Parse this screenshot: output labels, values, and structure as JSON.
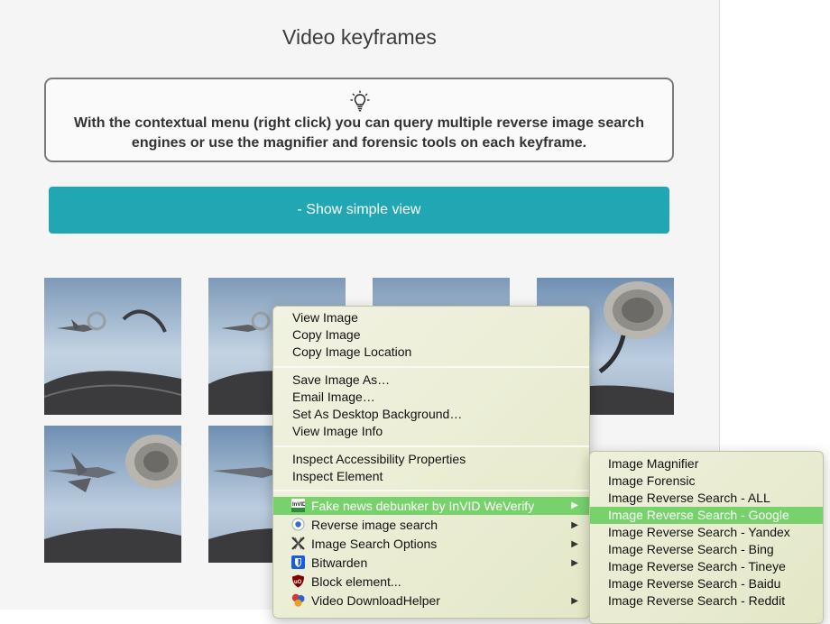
{
  "page": {
    "title": "Video keyframes",
    "tip_text": "With the contextual menu (right click) you can query multiple reverse image search engines or use the magnifier and forensic tools on each keyframe.",
    "toggle_button": "- Show simple view"
  },
  "keyframes": {
    "count_visible": 8
  },
  "context_menu": {
    "items": [
      {
        "label": "View Image"
      },
      {
        "label": "Copy Image"
      },
      {
        "label": "Copy Image Location"
      },
      {
        "label": "Save Image As…"
      },
      {
        "label": "Email Image…"
      },
      {
        "label": "Set As Desktop Background…"
      },
      {
        "label": "View Image Info"
      },
      {
        "label": "Inspect Accessibility Properties"
      },
      {
        "label": "Inspect Element"
      },
      {
        "label": "Fake news debunker by InVID  WeVerify",
        "icon": "invid-icon",
        "submenu": true,
        "highlighted": true
      },
      {
        "label": "Reverse image search",
        "icon": "reverse-search-icon",
        "submenu": true
      },
      {
        "label": "Image Search Options",
        "icon": "image-search-options-icon",
        "submenu": true
      },
      {
        "label": "Bitwarden",
        "icon": "bitwarden-icon",
        "submenu": true
      },
      {
        "label": "Block element...",
        "icon": "ublock-icon"
      },
      {
        "label": "Video DownloadHelper",
        "icon": "downloadhelper-icon",
        "submenu": true
      }
    ]
  },
  "submenu": {
    "items": [
      {
        "label": "Image Magnifier"
      },
      {
        "label": "Image Forensic"
      },
      {
        "label": "Image Reverse Search - ALL"
      },
      {
        "label": "Image Reverse Search - Google",
        "highlighted": true
      },
      {
        "label": "Image Reverse Search - Yandex"
      },
      {
        "label": "Image Reverse Search - Bing"
      },
      {
        "label": "Image Reverse Search - Tineye"
      },
      {
        "label": "Image Reverse Search - Baidu"
      },
      {
        "label": "Image Reverse Search - Reddit"
      }
    ]
  },
  "colors": {
    "accent_button": "#20a7b3",
    "menu_highlight": "#77d26c",
    "sky": "#b9cde0",
    "cockpit": "#2b2a2b"
  },
  "icons": {
    "tip": "lightbulb-icon",
    "submenu_arrow": "▶"
  }
}
